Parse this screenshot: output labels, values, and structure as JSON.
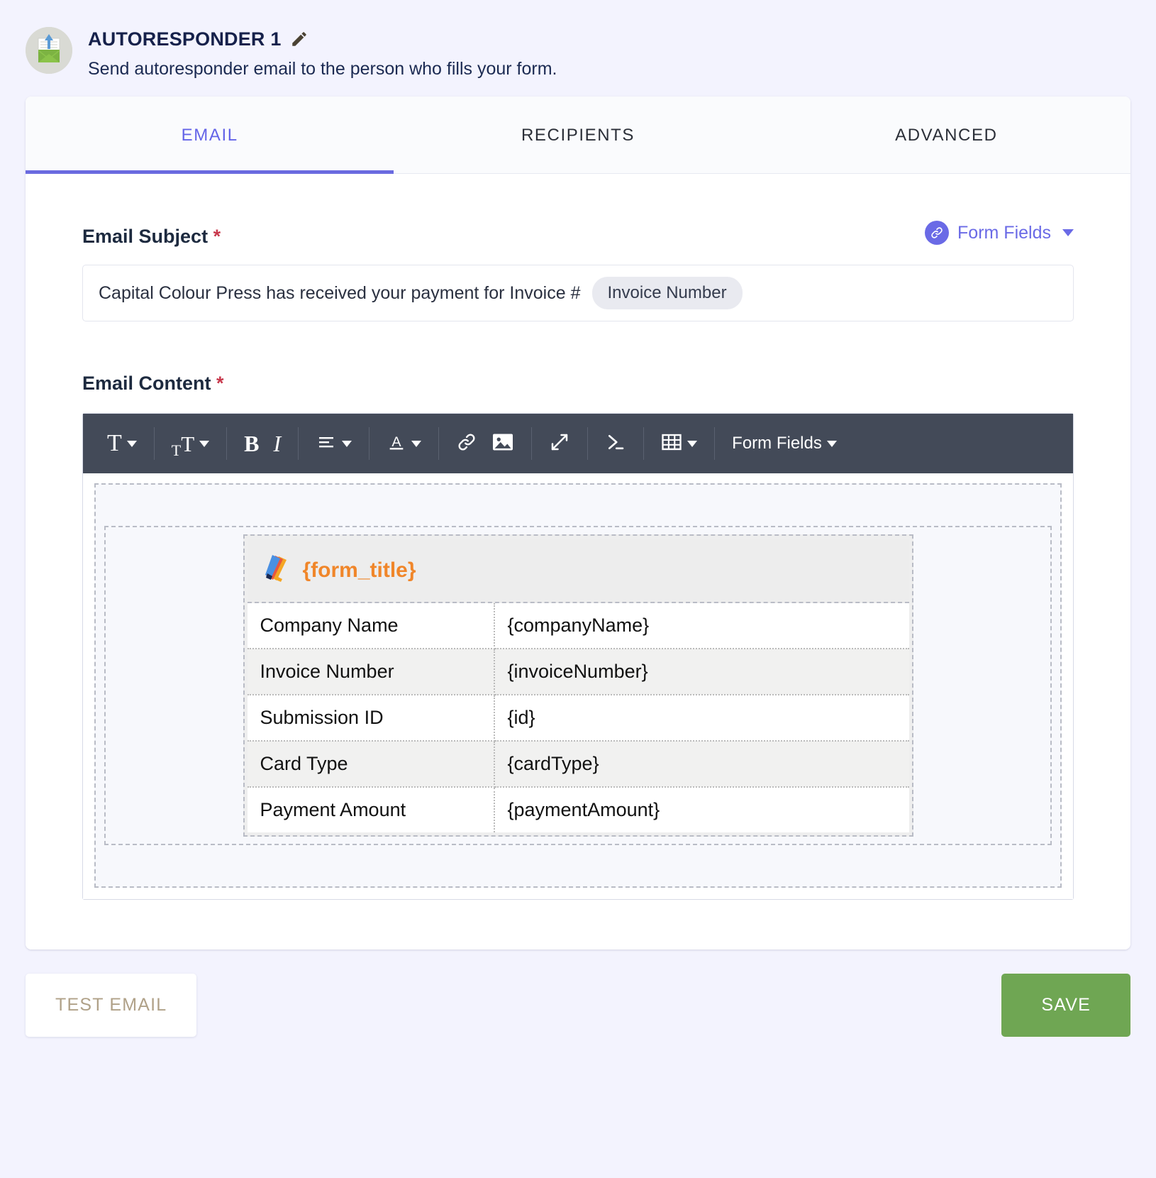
{
  "header": {
    "title": "AUTORESPONDER 1",
    "subtitle": "Send autoresponder email to the person who fills your form.",
    "edit_icon": "pencil-icon",
    "avatar_icon": "email-upload-icon"
  },
  "tabs": [
    {
      "label": "EMAIL",
      "active": true
    },
    {
      "label": "RECIPIENTS",
      "active": false
    },
    {
      "label": "ADVANCED",
      "active": false
    }
  ],
  "subject": {
    "label": "Email Subject",
    "required_mark": "*",
    "value": "Capital Colour Press has received your payment for Invoice #",
    "chip": "Invoice Number",
    "form_fields_link": "Form Fields",
    "form_fields_icon": "link-icon",
    "caret_icon": "chevron-down-icon"
  },
  "content": {
    "label": "Email Content",
    "required_mark": "*",
    "toolbar": [
      {
        "name": "font-family-dropdown",
        "glyph": "T",
        "caret": true
      },
      {
        "name": "font-size-dropdown",
        "glyph": "TT",
        "caret": true
      },
      {
        "name": "bold-button",
        "glyph": "B",
        "caret": false
      },
      {
        "name": "italic-button",
        "glyph": "I",
        "caret": false
      },
      {
        "name": "align-dropdown",
        "glyph": "align-icon",
        "caret": true
      },
      {
        "name": "text-color-dropdown",
        "glyph": "A",
        "caret": true
      },
      {
        "name": "insert-link-button",
        "glyph": "link-icon",
        "caret": false
      },
      {
        "name": "insert-image-button",
        "glyph": "image-icon",
        "caret": false
      },
      {
        "name": "fullscreen-button",
        "glyph": "expand-icon",
        "caret": false
      },
      {
        "name": "source-code-button",
        "glyph": "code-icon",
        "caret": false
      },
      {
        "name": "table-dropdown",
        "glyph": "table-icon",
        "caret": true
      },
      {
        "name": "form-fields-dropdown",
        "glyph": "Form Fields",
        "caret": true
      }
    ],
    "form_title_placeholder": "{form_title}",
    "logo_icon": "jotform-logo-icon",
    "table_rows": [
      {
        "key": "Company Name",
        "value": "{companyName}"
      },
      {
        "key": "Invoice Number",
        "value": "{invoiceNumber}"
      },
      {
        "key": "Submission ID",
        "value": "{id}"
      },
      {
        "key": "Card Type",
        "value": "{cardType}"
      },
      {
        "key": "Payment Amount",
        "value": "{paymentAmount}"
      }
    ]
  },
  "footer": {
    "test_email_label": "TEST EMAIL",
    "save_label": "SAVE"
  },
  "colors": {
    "accent": "#6a6ae6",
    "save_green": "#6fa653",
    "required_red": "#c8384c",
    "toolbar_bg": "#434a58",
    "form_title_orange": "#f0862a",
    "page_bg": "#f3f3fe"
  }
}
